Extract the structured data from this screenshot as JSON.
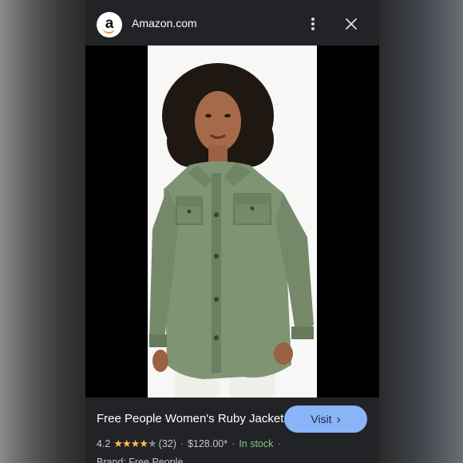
{
  "header": {
    "site_name": "Amazon.com",
    "logo_letter": "a",
    "logo_accent": "#f29b1d"
  },
  "product": {
    "title": "Free People Women's Ruby Jacket",
    "rating": "4.2",
    "rating_value": 4.2,
    "rating_max": 5,
    "review_count": "(32)",
    "price": "$128.00*",
    "availability": "In stock",
    "brand_line": "Brand: Free People"
  },
  "actions": {
    "visit_label": "Visit",
    "visit_color": "#8ab4f8"
  },
  "icons": {
    "more": "more-vert-icon",
    "close": "close-icon",
    "visit_arrow": "chevron-right-icon"
  }
}
